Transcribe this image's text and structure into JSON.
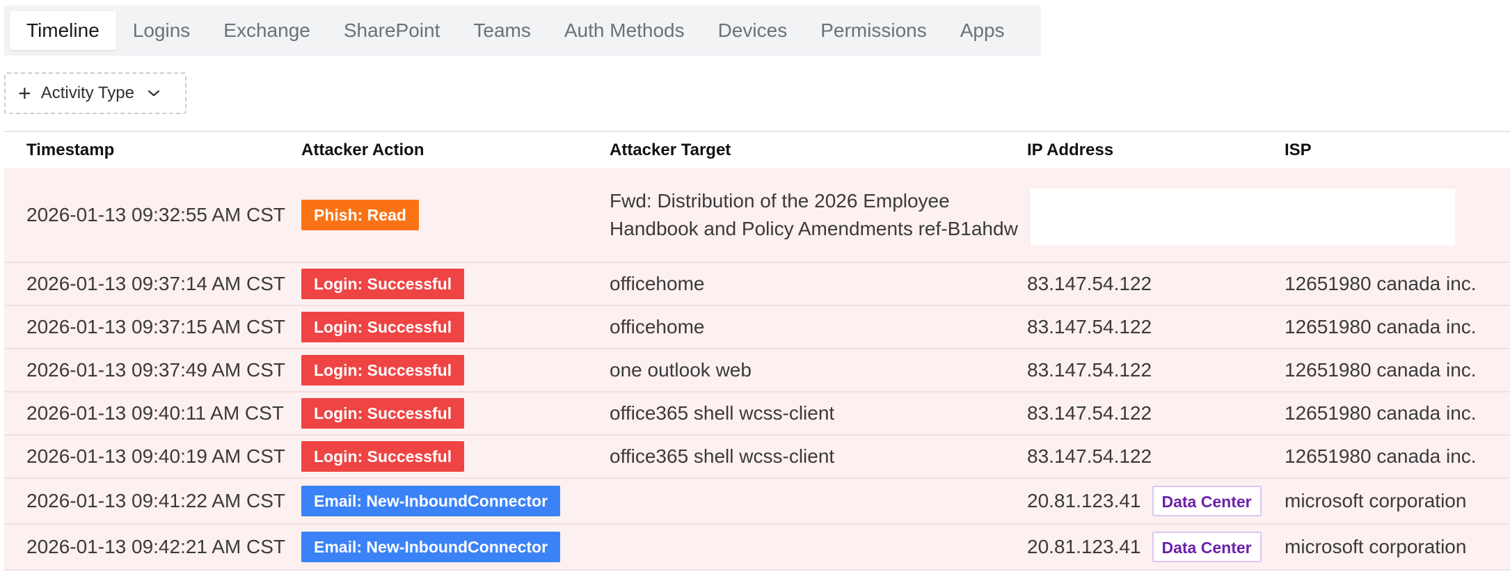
{
  "tabs": [
    {
      "label": "Timeline"
    },
    {
      "label": "Logins"
    },
    {
      "label": "Exchange"
    },
    {
      "label": "SharePoint"
    },
    {
      "label": "Teams"
    },
    {
      "label": "Auth Methods"
    },
    {
      "label": "Devices"
    },
    {
      "label": "Permissions"
    },
    {
      "label": "Apps"
    }
  ],
  "filter": {
    "label": "Activity Type"
  },
  "table": {
    "headers": [
      "Timestamp",
      "Attacker Action",
      "Attacker Target",
      "IP Address",
      "ISP"
    ],
    "rows": [
      {
        "timestamp": "2026-01-13 09:32:55 AM CST",
        "action": "Phish: Read",
        "target": "Fwd: Distribution of the 2026 Employee Handbook and Policy Amendments ref-B1ahdw",
        "ip": "",
        "ip_tag": "",
        "isp": ""
      },
      {
        "timestamp": "2026-01-13 09:37:14 AM CST",
        "action": "Login: Successful",
        "target": "officehome",
        "ip": "83.147.54.122",
        "ip_tag": "",
        "isp": "12651980 canada inc."
      },
      {
        "timestamp": "2026-01-13 09:37:15 AM CST",
        "action": "Login: Successful",
        "target": "officehome",
        "ip": "83.147.54.122",
        "ip_tag": "",
        "isp": "12651980 canada inc."
      },
      {
        "timestamp": "2026-01-13 09:37:49 AM CST",
        "action": "Login: Successful",
        "target": "one outlook web",
        "ip": "83.147.54.122",
        "ip_tag": "",
        "isp": "12651980 canada inc."
      },
      {
        "timestamp": "2026-01-13 09:40:11 AM CST",
        "action": "Login: Successful",
        "target": "office365 shell wcss-client",
        "ip": "83.147.54.122",
        "ip_tag": "",
        "isp": "12651980 canada inc."
      },
      {
        "timestamp": "2026-01-13 09:40:19 AM CST",
        "action": "Login: Successful",
        "target": "office365 shell wcss-client",
        "ip": "83.147.54.122",
        "ip_tag": "",
        "isp": "12651980 canada inc."
      },
      {
        "timestamp": "2026-01-13 09:41:22 AM CST",
        "action": "Email: New-InboundConnector",
        "target": "",
        "ip": "20.81.123.41",
        "ip_tag": "Data Center",
        "isp": "microsoft corporation"
      },
      {
        "timestamp": "2026-01-13 09:42:21 AM CST",
        "action": "Email: New-InboundConnector",
        "target": "",
        "ip": "20.81.123.41",
        "ip_tag": "Data Center",
        "isp": "microsoft corporation"
      }
    ]
  },
  "colors": {
    "phish": "#f97316",
    "login": "#ef4444",
    "email": "#3b82f6",
    "row_bg": "#fdf0f0",
    "data_center": "#6b21a8"
  },
  "icons": {
    "filter_add": "plus-icon",
    "filter_dropdown": "chevron-down-icon"
  }
}
